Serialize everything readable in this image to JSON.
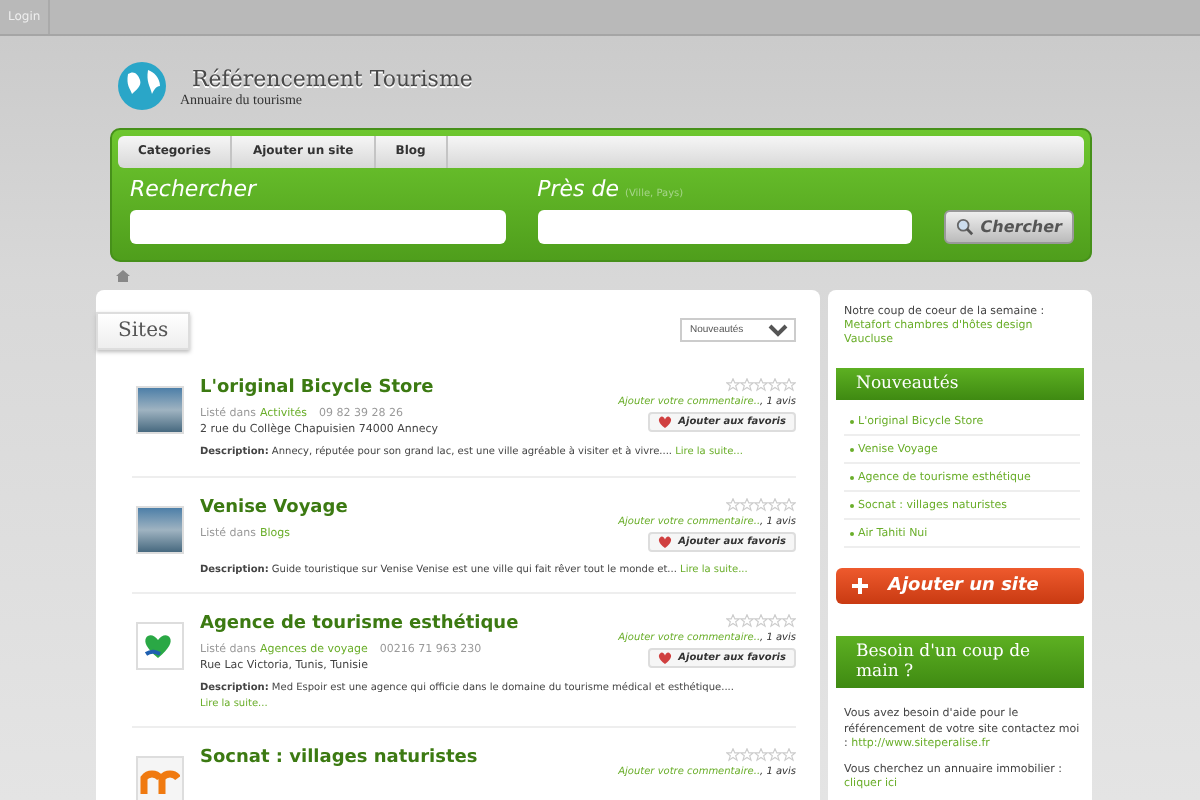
{
  "top_bar": {
    "login": "Login"
  },
  "header": {
    "title": "Référencement Tourisme",
    "subtitle": "Annuaire du tourisme"
  },
  "nav": {
    "items": [
      {
        "label": "Categories"
      },
      {
        "label": "Ajouter un site"
      },
      {
        "label": "Blog"
      }
    ]
  },
  "search": {
    "what_label": "Rechercher",
    "where_label": "Près de",
    "where_hint": "(Ville, Pays)",
    "button": "Chercher"
  },
  "sites": {
    "title": "Sites",
    "sort": "Nouveautés",
    "listings": [
      {
        "kind": "photo",
        "title": "L'original Bicycle Store",
        "listed_in": "Listé dans",
        "category": "Activités",
        "phone": "09 82 39 28 26",
        "address": "2 rue du Collège Chapuisien 74000 Annecy",
        "description": "**Description:** Annecy, réputée pour son grand lac, est une ville agréable à visiter et à vivre....",
        "more": "Lire la suite...",
        "stars": 0,
        "comment_link": "Ajouter votre commentaire..",
        "reviews": ", 1 avis",
        "favorite": "Ajouter aux favoris"
      },
      {
        "kind": "photo",
        "title": "Venise Voyage",
        "listed_in": "Listé dans",
        "category": "Blogs",
        "description": "**Description:** Guide touristique sur Venise Venise est une ville qui fait rêver tout le monde et...",
        "more": "Lire la suite...",
        "stars": 0,
        "comment_link": "Ajouter votre commentaire..",
        "reviews": ", 1 avis",
        "favorite": "Ajouter aux favoris"
      },
      {
        "kind": "heart-logo",
        "title": "Agence de tourisme esthétique",
        "listed_in": "Listé dans",
        "category": "Agences de voyage",
        "phone": "00216 71 963 230",
        "address": "Rue Lac Victoria, Tunis, Tunisie",
        "description": "**Description:** Med Espoir est une agence qui officie dans le domaine du tourisme médical et esthétique....",
        "more": "Lire la suite...",
        "stars": 0,
        "comment_link": "Ajouter votre commentaire..",
        "reviews": ", 1 avis",
        "favorite": "Ajouter aux favoris"
      },
      {
        "kind": "orange-logo",
        "title": "Socnat : villages naturistes",
        "stars": 0,
        "comment_link": "Ajouter votre commentaire..",
        "reviews": ", 1 avis"
      }
    ]
  },
  "sidebar": {
    "featured_text": "Notre coup de coeur de la semaine :",
    "featured_link": "Metafort chambres d'hôtes design Vaucluse",
    "new_title": "Nouveautés",
    "new_items": [
      "L'original Bicycle Store",
      "Venise Voyage",
      "Agence de tourisme esthétique",
      "Socnat : villages naturistes",
      "Air Tahiti Nui"
    ],
    "add_button": "Ajouter un site",
    "help_title": "Besoin d'un coup de main ?",
    "help_text": "Vous avez besoin d'aide pour le référencement de votre site contactez moi :",
    "help_link": "http://www.siteperalise.fr",
    "realestate_text": "Vous cherchez un annuaire immobilier :",
    "realestate_link": "cliquer ici"
  }
}
